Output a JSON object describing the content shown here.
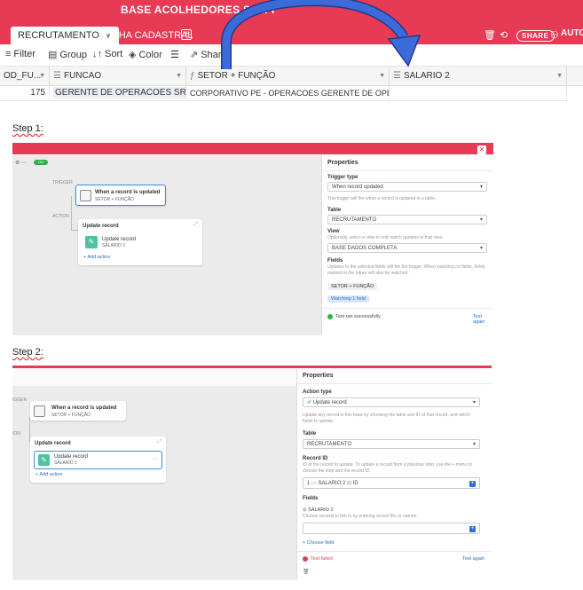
{
  "base_title": "BASE ACOLHEDORES SELFI",
  "tabs": {
    "active_label": "RECRUTAMENTO",
    "other_label": "FICHA CADASTRAL",
    "share_label": "SHARE",
    "automations_label": "AUTO"
  },
  "toolbar": {
    "filter": "Filter",
    "group": "Group",
    "sort": "Sort",
    "color": "Color",
    "share": "Share"
  },
  "grid": {
    "columns": [
      "OD_FU...",
      "FUNCAO",
      "SETOR + FUNÇÃO",
      "SALARIO 2"
    ],
    "row": {
      "id": "175",
      "funcao": "GERENTE DE OPERACOES SR",
      "setor_funcao": "CORPORATIVO PE - OPERACOES GERENTE DE OPERACOES SR",
      "salario2": ""
    }
  },
  "steps": {
    "step1": "Step 1:",
    "step2": "Step 2:"
  },
  "step1": {
    "trigger_section": "TRIGGER",
    "action_section": "ACTION",
    "trigger_title": "When a record is updated",
    "trigger_sub": "SETOR + FUNÇÃO",
    "action_group_title": "Update record",
    "action_title": "Update record",
    "action_sub": "SALARIO 2",
    "add_action": "+ Add action",
    "toggle_label": "ON",
    "properties": {
      "title": "Properties",
      "trigger_type_label": "Trigger type",
      "trigger_type_value": "When record updated",
      "trigger_desc": "This trigger will fire when a record is updated in a table.",
      "table_label": "Table",
      "table_value": "RECRUTAMENTO",
      "view_label": "View",
      "view_desc": "Optionally, select a view to only watch updates in that view.",
      "view_value": "BASE DADOS COMPLETA",
      "fields_label": "Fields",
      "fields_desc": "Updates to the selected fields will fire the trigger. When watching no fields, fields marked in the future will also be watched.",
      "field_chip": "SETOR + FUNÇÃO",
      "watching": "Watching 1 field",
      "test_status": "Test ran successfully",
      "test_again": "Test again"
    }
  },
  "step2": {
    "trigger_title": "When a record is updated",
    "trigger_sub": "SETOR + FUNÇÃO",
    "action_group_title": "Update record",
    "action_title": "Update record",
    "action_sub": "SALARIO 2",
    "add_action": "+ Add action",
    "properties": {
      "title": "Properties",
      "action_type_label": "Action type",
      "action_type_value": "Update record",
      "action_desc": "Update any record in this base by choosing the table and ID of that record, and which fields to update.",
      "table_label": "Table",
      "table_value": "RECRUTAMENTO",
      "record_id_label": "Record ID",
      "record_id_desc": "ID of the record to update. To update a record from a previous step, use the + menu to choose the step and the record ID.",
      "record_id_step": "1",
      "record_id_field": "SALARIO 2",
      "record_id_tag": "ID",
      "fields_label": "Fields",
      "field_name": "SALARIO 2",
      "field_desc": "Choose records to link to by entering record IDs or names.",
      "choose_field": "+ Choose field",
      "test_status": "Test failed",
      "test_again": "Test again"
    }
  },
  "colors": {
    "brand_red": "#e73a55",
    "accent_blue": "#2f6fd6",
    "success_green": "#2db24a"
  }
}
